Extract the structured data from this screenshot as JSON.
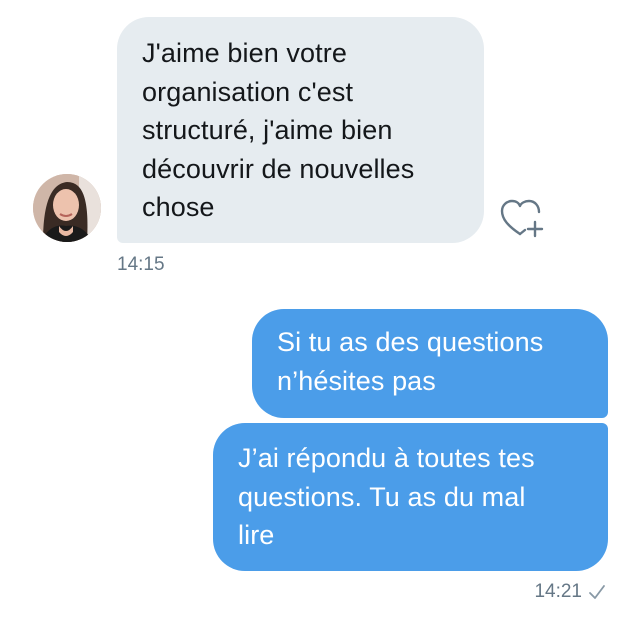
{
  "messages": {
    "received": {
      "text": "J'aime bien votre\norganisation c'est\nstructuré, j'aime bien\ndécouvrir de nouvelles\nchose",
      "time": "14:15",
      "avatar_icon": "user-avatar",
      "reaction_icon": "heart-plus-icon"
    },
    "sent": [
      {
        "text": "Si tu as des questions\nn’hésites pas"
      },
      {
        "text": "J’ai répondu à toutes tes\nquestions. Tu as du mal\nlire"
      }
    ],
    "sent_time": "14:21",
    "sent_status_icon": "checkmark-icon"
  },
  "colors": {
    "received_bubble": "#e6ecf0",
    "sent_bubble": "#4b9de9",
    "timestamp": "#657786"
  }
}
